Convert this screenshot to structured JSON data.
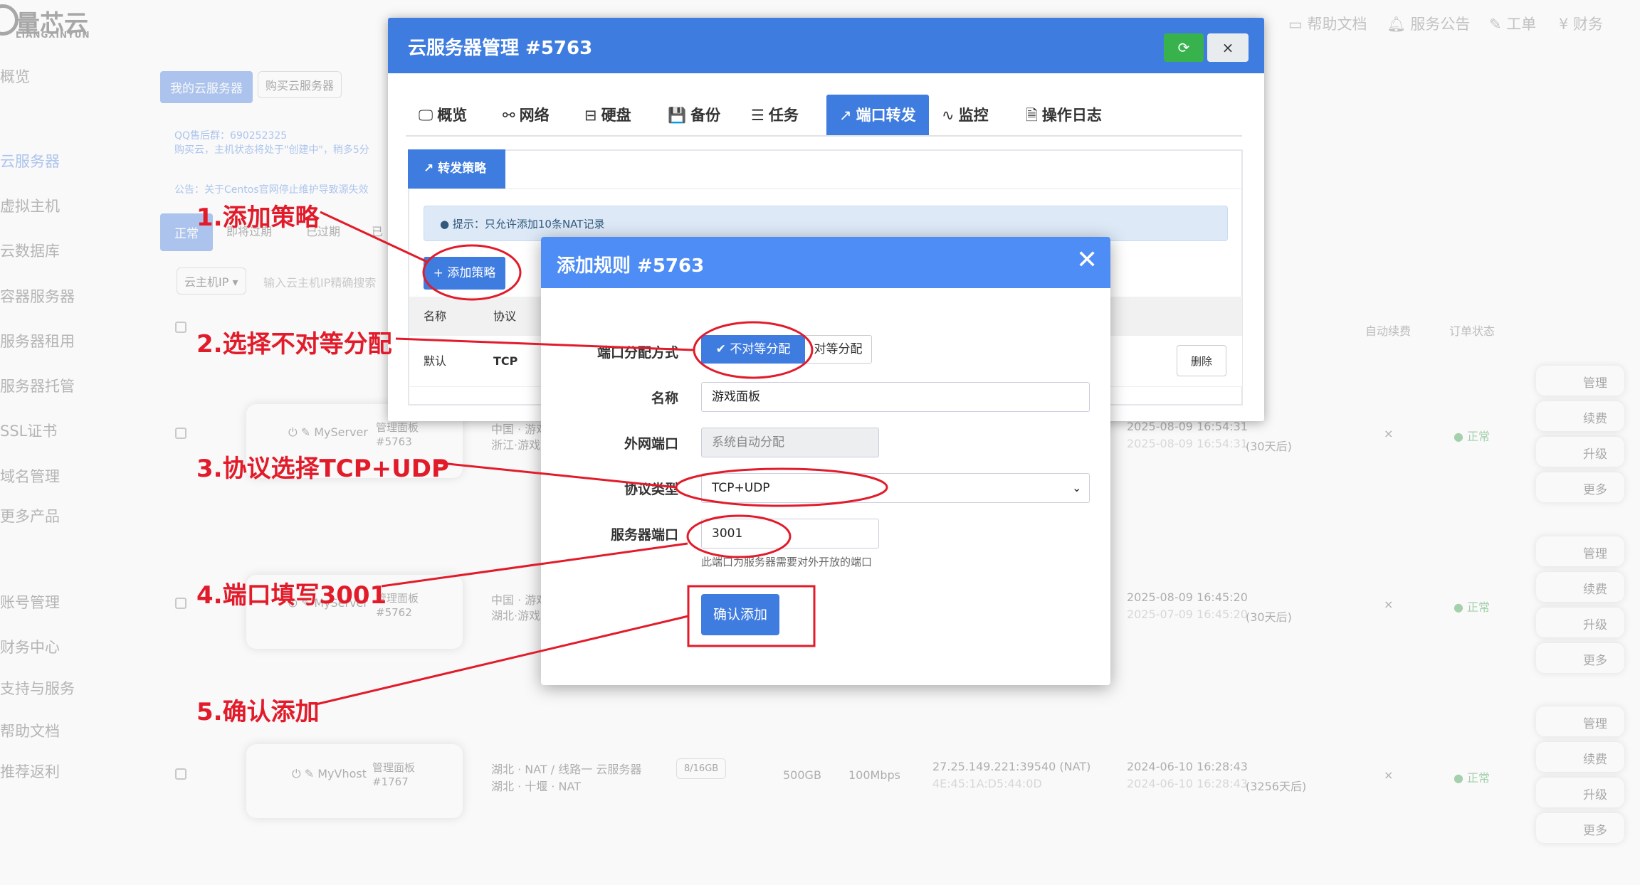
{
  "app": {
    "logo_text": "量芯云",
    "logo_sub": "LIANGXINYUN"
  },
  "topnav": {
    "help": "帮助文档",
    "notice": "服务公告",
    "ticket": "工单",
    "finance": "财务"
  },
  "sidebar": {
    "items": [
      "概览",
      "云服务器",
      "虚拟主机",
      "云数据库",
      "容器服务器",
      "服务器租用",
      "服务器托管",
      "SSL证书",
      "域名管理",
      "更多产品",
      "账号管理",
      "财务中心",
      "支持与服务",
      "帮助文档",
      "推荐返利"
    ]
  },
  "background": {
    "btn_my_servers": "我的云服务器",
    "btn_buy": "购买云服务器",
    "notice_qq": "QQ售后群：690252325",
    "notice_state": "购买云，主机状态将处于\"创建中\"，稍多5分",
    "notice_centos": "公告：关于Centos官网停止维护导致源失效",
    "filter_tabs": [
      "正常",
      "即将过期",
      "已过期",
      "已"
    ],
    "filter_select": "云主机IP",
    "filter_placeholder": "输入云主机IP精确搜索",
    "col_auto_renew": "自动续费",
    "col_order_status": "订单状态",
    "actions": {
      "manage": "管理",
      "renew": "续费",
      "upgrade": "升级",
      "more": "更多"
    },
    "rows": [
      {
        "name": "MyServer",
        "panel": "管理面板",
        "id": "#5763",
        "location1": "中国 · 游戏",
        "location2": "浙江·游戏",
        "date": "2025-08-09 16:54:31",
        "date2": "2025-08-09 16:54:31",
        "remain": "(30天后)",
        "renew": "×",
        "status": "正常"
      },
      {
        "name": "MyServer",
        "panel": "管理面板",
        "id": "#5762",
        "location1": "中国 · 游戏",
        "location2": "湖北·游戏",
        "date": "2025-08-09 16:45:20",
        "date2": "2025-07-09 16:45:20",
        "remain": "(30天后)",
        "renew": "×",
        "status": "正常"
      },
      {
        "name": "MyVhost",
        "panel": "管理面板",
        "id": "#1767",
        "location1": "湖北 · NAT / 线路一 云服务器",
        "location2": "湖北 · 十堰 · NAT",
        "mem": "8/16GB",
        "disk": "500GB",
        "bw": "100Mbps",
        "ip": "27.25.149.221:39540 (NAT)",
        "mac": "4E:45:1A:D5:44:0D",
        "date": "2024-06-10 16:28:43",
        "date2": "2024-06-10 16:28:43",
        "remain": "(3256天后)",
        "renew": "×",
        "status": "正常"
      }
    ]
  },
  "server_window": {
    "title": "云服务器管理 #5763",
    "refresh_icon": "refresh-icon",
    "close_label": "×",
    "tabs": [
      {
        "icon": "🖵",
        "label": "概览"
      },
      {
        "icon": "⚯",
        "label": "网络"
      },
      {
        "icon": "⊟",
        "label": "硬盘"
      },
      {
        "icon": "💾",
        "label": "备份"
      },
      {
        "icon": "☰",
        "label": "任务"
      },
      {
        "icon": "↗",
        "label": "端口转发"
      },
      {
        "icon": "∿",
        "label": "监控"
      },
      {
        "icon": "🗎",
        "label": "操作日志"
      }
    ],
    "subtab": "转发策略",
    "tip": "提示：只允许添加10条NAT记录",
    "add_policy": "+ 添加策略",
    "table_headers": [
      "名称",
      "协议"
    ],
    "row": {
      "name": "默认",
      "protocol": "TCP"
    },
    "delete_label": "删除"
  },
  "modal": {
    "title": "添加规则 #5763",
    "close": "✕",
    "port_mode_label": "端口分配方式",
    "mode_unequal": "不对等分配",
    "mode_equal": "对等分配",
    "name_label": "名称",
    "name_value": "游戏面板",
    "ext_port_label": "外网端口",
    "ext_port_placeholder": "系统自动分配",
    "protocol_label": "协议类型",
    "protocol_value": "TCP+UDP",
    "server_port_label": "服务器端口",
    "server_port_value": "3001",
    "server_port_help": "此端口为服务器需要对外开放的端口",
    "confirm": "确认添加"
  },
  "annotations": {
    "step1": "1.添加策略",
    "step2": "2.选择不对等分配",
    "step3": "3.协议选择TCP+UDP",
    "step4": "4.端口填写3001",
    "step5": "5.确认添加"
  },
  "colors": {
    "primary": "#3f7ce0",
    "modal_header": "#4e8df5",
    "annotation": "#e21b2a",
    "success": "#37b24d"
  }
}
